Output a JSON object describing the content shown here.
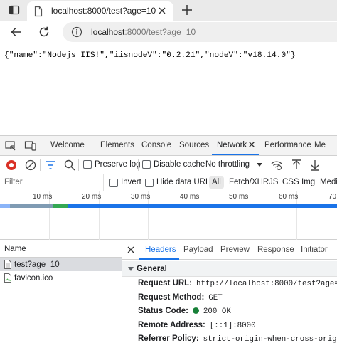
{
  "browser": {
    "tab_title": "localhost:8000/test?age=10",
    "url_host": "localhost",
    "url_rest": ":8000/test?age=10"
  },
  "page": {
    "body_text": "{\"name\":\"Nodejs IIS!\",\"iisnodeV\":\"0.2.21\",\"nodeV\":\"v18.14.0\"}"
  },
  "devtools": {
    "tabs": [
      "Welcome",
      "Elements",
      "Console",
      "Sources",
      "Network",
      "Performance",
      "Me"
    ],
    "active_tab": "Network",
    "toolbar": {
      "preserve_log": "Preserve log",
      "disable_cache": "Disable cache",
      "throttling": "No throttling"
    },
    "filter": {
      "placeholder": "Filter",
      "invert": "Invert",
      "hide_data_urls": "Hide data URLs",
      "types": [
        "All",
        "Fetch/XHR",
        "JS",
        "CSS",
        "Img",
        "Medi"
      ],
      "selected_type": "All"
    },
    "timeline_ticks": [
      "10 ms",
      "20 ms",
      "30 ms",
      "40 ms",
      "50 ms",
      "60 ms",
      "70"
    ],
    "requests": {
      "column": "Name",
      "rows": [
        "test?age=10",
        "favicon.ico"
      ],
      "selected": "test?age=10"
    },
    "details": {
      "tabs": [
        "Headers",
        "Payload",
        "Preview",
        "Response",
        "Initiator"
      ],
      "active_tab": "Headers",
      "section": "General",
      "fields": [
        {
          "key": "Request URL:",
          "value": "http://localhost:8000/test?age=10"
        },
        {
          "key": "Request Method:",
          "value": "GET"
        },
        {
          "key": "Status Code:",
          "value": "200 OK"
        },
        {
          "key": "Remote Address:",
          "value": "[::1]:8000"
        },
        {
          "key": "Referrer Policy:",
          "value": "strict-origin-when-cross-origin"
        }
      ]
    }
  },
  "colors": {
    "accent": "#1a73e8",
    "status_ok": "#188038",
    "record_red": "#d93025"
  }
}
